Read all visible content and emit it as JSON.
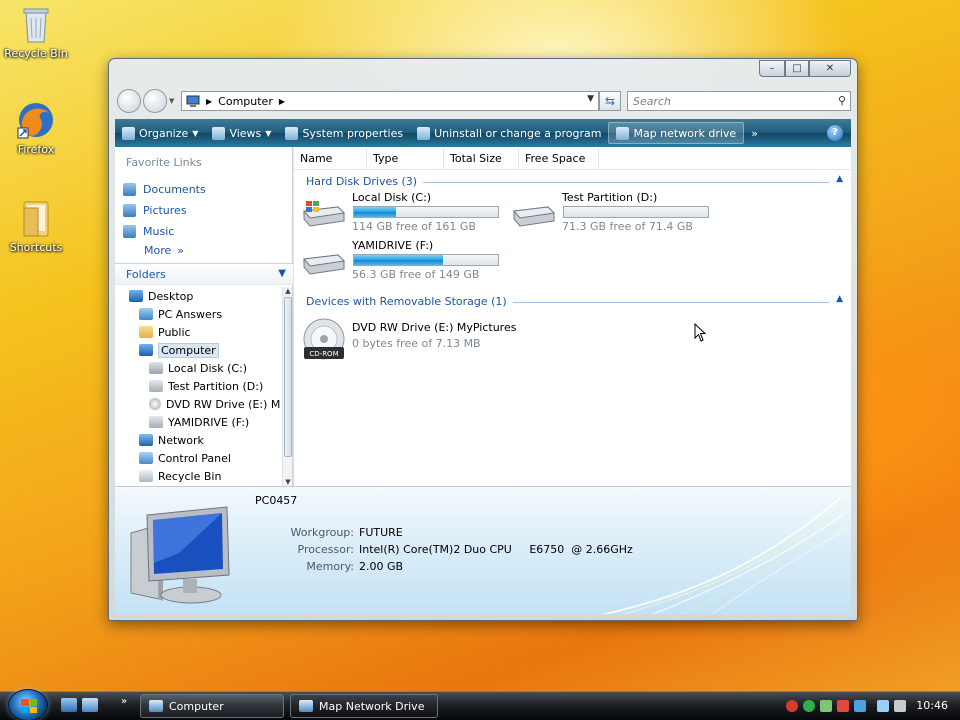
{
  "desktop": {
    "icons": [
      {
        "label": "Recycle Bin"
      },
      {
        "label": "Firefox"
      },
      {
        "label": "Shortcuts"
      }
    ]
  },
  "window": {
    "address": {
      "crumb": "Computer"
    },
    "search": {
      "placeholder": "Search"
    },
    "toolbar": {
      "organize": "Organize",
      "views": "Views",
      "system_properties": "System properties",
      "uninstall": "Uninstall or change a program",
      "map_drive": "Map network drive",
      "more": "»",
      "help": "?"
    },
    "favorites": {
      "heading": "Favorite Links",
      "items": [
        {
          "label": "Documents"
        },
        {
          "label": "Pictures"
        },
        {
          "label": "Music"
        }
      ],
      "more": "More",
      "more_chevron": "»"
    },
    "folders": {
      "heading": "Folders",
      "tree": [
        {
          "label": "Desktop"
        },
        {
          "label": "PC Answers"
        },
        {
          "label": "Public"
        },
        {
          "label": "Computer"
        },
        {
          "label": "Local Disk (C:)"
        },
        {
          "label": "Test Partition (D:)"
        },
        {
          "label": "DVD RW Drive (E:) M"
        },
        {
          "label": "YAMIDRIVE (F:)"
        },
        {
          "label": "Network"
        },
        {
          "label": "Control Panel"
        },
        {
          "label": "Recycle Bin"
        }
      ]
    },
    "columns": [
      "Name",
      "Type",
      "Total Size",
      "Free Space"
    ],
    "groups": {
      "hdd": {
        "title": "Hard Disk Drives (3)"
      },
      "removable": {
        "title": "Devices with Removable Storage (1)"
      }
    },
    "drives": [
      {
        "name": "Local Disk (C:)",
        "free": "114 GB free of 161 GB",
        "used_fraction": 0.29
      },
      {
        "name": "Test Partition (D:)",
        "free": "71.3 GB free of 71.4 GB",
        "used_fraction": 0.0
      },
      {
        "name": "YAMIDRIVE (F:)",
        "free": "56.3 GB free of 149 GB",
        "used_fraction": 0.62
      }
    ],
    "removable": {
      "name": "DVD RW Drive (E:) MyPictures",
      "free": "0 bytes free of 7.13 MB",
      "badge": "CD-ROM"
    },
    "details": {
      "computer_name": "PC0457",
      "rows": [
        {
          "label": "Workgroup:",
          "value": "FUTURE"
        },
        {
          "label": "Processor:",
          "value": "Intel(R) Core(TM)2 Duo CPU     E6750  @ 2.66GHz"
        },
        {
          "label": "Memory:",
          "value": "2.00 GB"
        }
      ]
    }
  },
  "taskbar": {
    "buttons": [
      {
        "label": "Computer"
      },
      {
        "label": "Map Network Drive"
      }
    ],
    "clock": "10:46"
  },
  "colors": {
    "accent": "#1c56a8",
    "toolbar": "#1e5a7a",
    "progress": "#26a0e0"
  }
}
